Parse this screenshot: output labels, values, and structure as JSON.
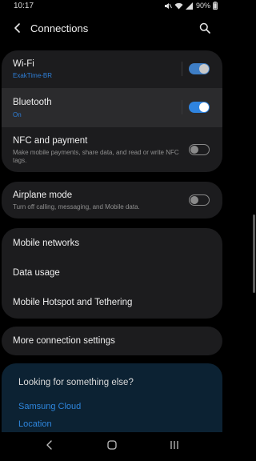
{
  "status_bar": {
    "time": "10:17",
    "battery_text": "90%"
  },
  "header": {
    "title": "Connections"
  },
  "toggles": [
    {
      "title": "Wi-Fi",
      "subtitle": "ExakTime-BR"
    },
    {
      "title": "Bluetooth",
      "subtitle": "On"
    },
    {
      "title": "NFC and payment",
      "subtitle": "Make mobile payments, share data, and read or write NFC tags."
    }
  ],
  "airplane": {
    "title": "Airplane mode",
    "subtitle": "Turn off calling, messaging, and Mobile data."
  },
  "networks": [
    {
      "title": "Mobile networks"
    },
    {
      "title": "Data usage"
    },
    {
      "title": "Mobile Hotspot and Tethering"
    }
  ],
  "more": {
    "title": "More connection settings"
  },
  "suggestions": {
    "title": "Looking for something else?",
    "links": [
      "Samsung Cloud",
      "Location"
    ]
  },
  "colors": {
    "accent": "#2e86dd",
    "card": "#1c1c1e",
    "suggest_bg": "#0c2233"
  },
  "icons": [
    "mute-icon",
    "wifi-icon",
    "signal-icon",
    "battery-icon",
    "back-arrow-icon",
    "search-icon",
    "nav-back-icon",
    "nav-home-icon",
    "nav-recents-icon"
  ]
}
